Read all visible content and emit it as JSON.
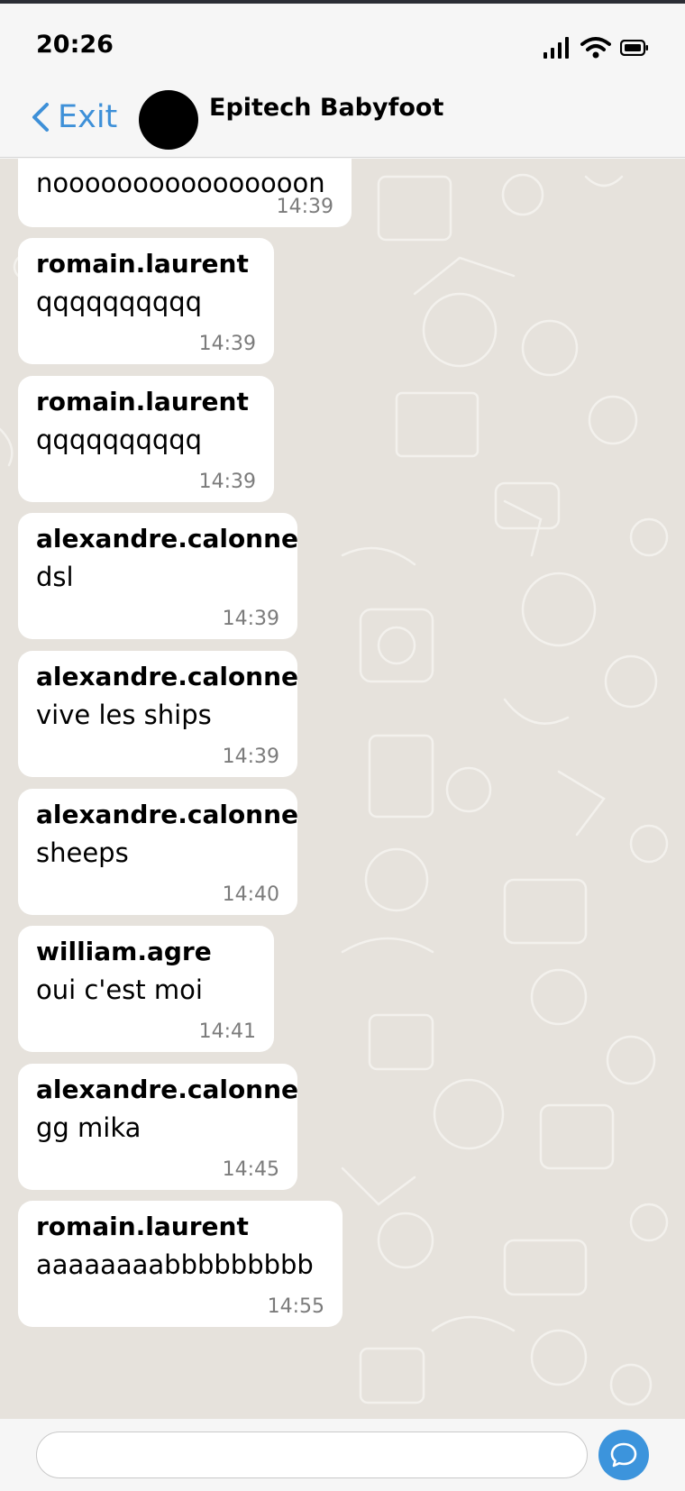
{
  "status_bar": {
    "time": "20:26"
  },
  "header": {
    "back_label": "Exit",
    "title": "Epitech Babyfoot"
  },
  "messages": [
    {
      "sender": "",
      "text": "noooooooooooooooon",
      "time": "14:39"
    },
    {
      "sender": "romain.laurent",
      "text": "qqqqqqqqqq",
      "time": "14:39"
    },
    {
      "sender": "romain.laurent",
      "text": "qqqqqqqqqq",
      "time": "14:39"
    },
    {
      "sender": "alexandre.calonne",
      "text": "dsl",
      "time": "14:39"
    },
    {
      "sender": "alexandre.calonne",
      "text": "vive les ships",
      "time": "14:39"
    },
    {
      "sender": "alexandre.calonne",
      "text": "sheeps",
      "time": "14:40"
    },
    {
      "sender": "william.agre",
      "text": "oui c'est moi",
      "time": "14:41"
    },
    {
      "sender": "alexandre.calonne",
      "text": "gg mika",
      "time": "14:45"
    },
    {
      "sender": "romain.laurent",
      "text": "aaaaaaaabbbbbbbbb",
      "time": "14:55"
    }
  ],
  "composer": {
    "value": "",
    "placeholder": ""
  },
  "colors": {
    "accent": "#3e90d8",
    "send_button": "#3c94dc",
    "chat_background": "#e6e2dc",
    "bubble": "#ffffff"
  }
}
